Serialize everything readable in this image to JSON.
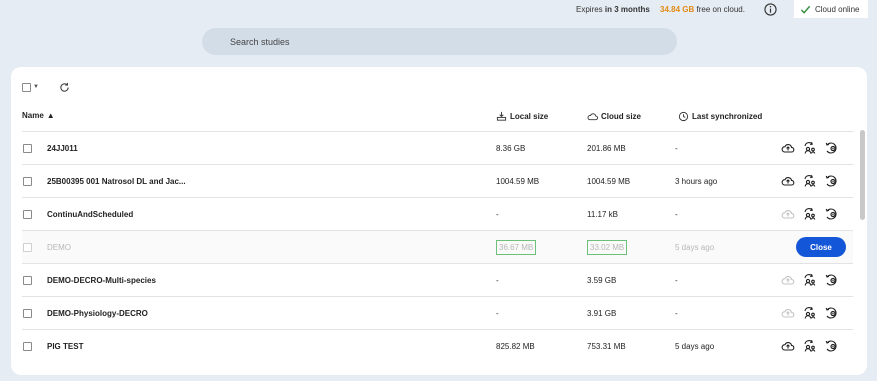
{
  "status": {
    "expires_prefix": "Expires",
    "expires_value": "in 3 months",
    "free_amount": "34.84 GB",
    "free_suffix": "free on cloud.",
    "cloud_status": "Cloud online"
  },
  "search": {
    "placeholder": "Search studies",
    "value": ""
  },
  "columns": {
    "name": "Name",
    "local_size": "Local size",
    "cloud_size": "Cloud size",
    "last_synchronized": "Last synchronized"
  },
  "sort_indicator": "▲",
  "rows": [
    {
      "name": "24JJ011",
      "local": "8.36 GB",
      "cloud": "201.86 MB",
      "sync": "-"
    },
    {
      "name": "25B00395 001 Natrosol DL and Jac...",
      "local": "1004.59 MB",
      "cloud": "1004.59 MB",
      "sync": "3 hours ago"
    },
    {
      "name": "ContinuAndScheduled",
      "local": "-",
      "cloud": "11.17 kB",
      "sync": "-"
    },
    {
      "name": "DEMO",
      "local": "36.67 MB",
      "cloud": "33.02 MB",
      "sync": "5 days ago",
      "action_label": "Close"
    },
    {
      "name": "DEMO-DECRO-Multi-species",
      "local": "-",
      "cloud": "3.59 GB",
      "sync": "-"
    },
    {
      "name": "DEMO-Physiology-DECRO",
      "local": "-",
      "cloud": "3.91 GB",
      "sync": "-"
    },
    {
      "name": "PIG TEST",
      "local": "825.82 MB",
      "cloud": "753.31 MB",
      "sync": "5 days ago"
    }
  ],
  "colors": {
    "accent": "#1456d8",
    "free_space": "#e38a17",
    "online": "#2e8b3a"
  }
}
